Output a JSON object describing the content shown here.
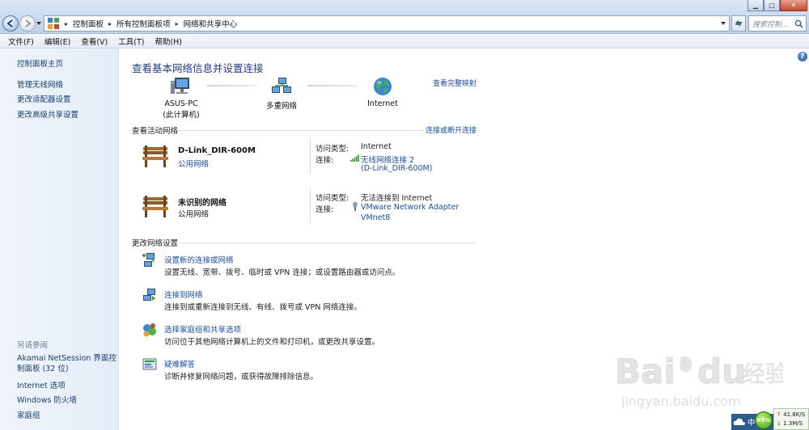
{
  "addressbar": {
    "breadcrumbs": [
      "控制面板",
      "所有控制面板项",
      "网络和共享中心"
    ],
    "search_placeholder": "搜索控制..."
  },
  "menu": [
    "文件(F)",
    "编辑(E)",
    "查看(V)",
    "工具(T)",
    "帮助(H)"
  ],
  "sidebar": {
    "home": "控制面板主页",
    "links": [
      "管理无线网络",
      "更改适配器设置",
      "更改高级共享设置"
    ],
    "see_also_title": "另请参阅",
    "see_also": [
      "Akamai NetSession 界面控制面板 (32 位)",
      "Internet 选项",
      "Windows 防火墙",
      "家庭组"
    ]
  },
  "main": {
    "title": "查看基本网络信息并设置连接",
    "full_map": "查看完整映射",
    "map": {
      "computer_name": "ASUS-PC",
      "computer_sub": "(此计算机)",
      "middle": "多重网络",
      "internet": "Internet"
    },
    "active_header": "查看活动网络",
    "connect_disconnect": "连接或断开连接",
    "networks": [
      {
        "name": "D-Link_DIR-600M",
        "type": "公用网络",
        "access_label": "访问类型:",
        "access": "Internet",
        "conn_label": "连接:",
        "conn_line1": "无线网络连接 2",
        "conn_line2": "(D-Link_DIR-600M)"
      },
      {
        "name": "未识别的网络",
        "type": "公用网络",
        "access_label": "访问类型:",
        "access": "无法连接到 Internet",
        "conn_label": "连接:",
        "conn_line1": "VMware Network Adapter",
        "conn_line2": "VMnet8"
      }
    ],
    "change_header": "更改网络设置",
    "tasks": [
      {
        "link": "设置新的连接或网络",
        "desc": "设置无线、宽带、拨号、临时或 VPN 连接；或设置路由器或访问点。"
      },
      {
        "link": "连接到网络",
        "desc": "连接到或重新连接到无线、有线、拨号或 VPN 网络连接。"
      },
      {
        "link": "选择家庭组和共享选项",
        "desc": "访问位于其他网络计算机上的文件和打印机，或更改共享设置。"
      },
      {
        "link": "疑难解答",
        "desc": "诊断并修复网络问题，或获得故障排除信息。"
      }
    ]
  },
  "watermark": {
    "brand": "Bai du 经验",
    "url": "jingyan.baidu.com"
  },
  "tray": {
    "ime": "中",
    "percent": "69%",
    "up_speed": "41.8K/S",
    "down_speed": "1.3M/S"
  },
  "colors": {
    "link": "#1a4fa8",
    "title": "#1e3a8a",
    "pane": "#e3ecf7"
  }
}
